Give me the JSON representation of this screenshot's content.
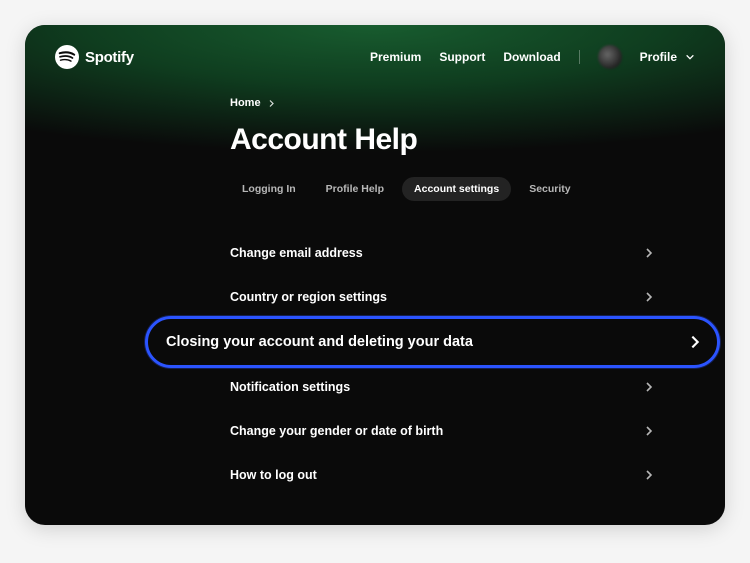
{
  "brand": {
    "name": "Spotify"
  },
  "nav": {
    "premium": "Premium",
    "support": "Support",
    "download": "Download",
    "profile": "Profile"
  },
  "breadcrumb": {
    "home": "Home"
  },
  "page": {
    "title": "Account Help"
  },
  "tabs": [
    {
      "label": "Logging In",
      "active": false
    },
    {
      "label": "Profile Help",
      "active": false
    },
    {
      "label": "Account settings",
      "active": true
    },
    {
      "label": "Security",
      "active": false
    }
  ],
  "items": [
    {
      "label": "Change email address",
      "highlighted": false
    },
    {
      "label": "Country or region settings",
      "highlighted": false
    },
    {
      "label": "Closing your account and deleting your data",
      "highlighted": true
    },
    {
      "label": "Notification settings",
      "highlighted": false
    },
    {
      "label": "Change your gender or date of birth",
      "highlighted": false
    },
    {
      "label": "How to log out",
      "highlighted": false
    }
  ]
}
